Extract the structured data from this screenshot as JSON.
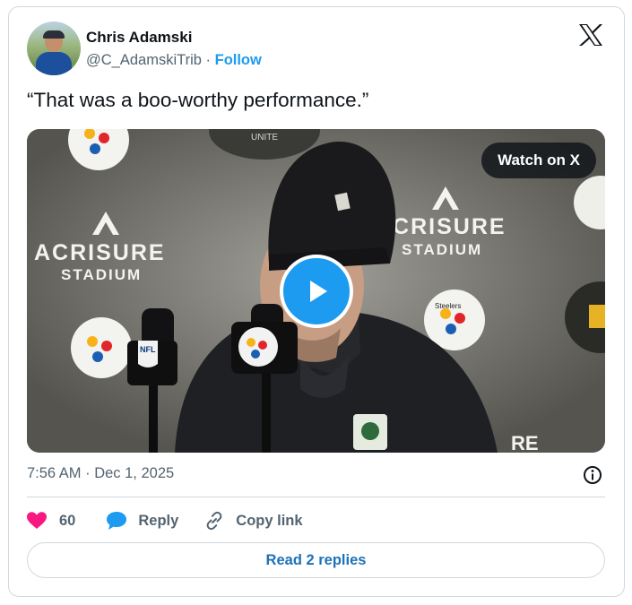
{
  "author": {
    "name": "Chris Adamski",
    "handle": "@C_AdamskiTrib",
    "separator": "·",
    "follow_label": "Follow"
  },
  "tweet": {
    "text": "“That was a boo-worthy performance.”",
    "timestamp": "7:56 AM · Dec 1, 2025"
  },
  "media": {
    "watch_label": "Watch on X",
    "backdrop_text": {
      "brand_left": "ACRISURE",
      "venue_left": "STADIUM",
      "brand_right": "ACRISURE",
      "venue_right": "STADIUM",
      "mic_logo": "NFL",
      "team_logo_text": "Steelers",
      "banner_top": "UNITE",
      "edge_fragment": "RE"
    }
  },
  "actions": {
    "like_count": "60",
    "reply_label": "Reply",
    "copy_label": "Copy link"
  },
  "footer": {
    "read_replies_label": "Read 2 replies"
  },
  "icons": {
    "brand": "x-logo-icon",
    "like": "heart-icon",
    "reply": "speech-bubble-icon",
    "copy": "link-icon",
    "info": "info-icon",
    "play": "play-icon"
  },
  "colors": {
    "accent": "#1d9bf0",
    "like": "#f91880",
    "text_primary": "#0f1419",
    "text_secondary": "#536471",
    "border": "#cfd9de"
  }
}
